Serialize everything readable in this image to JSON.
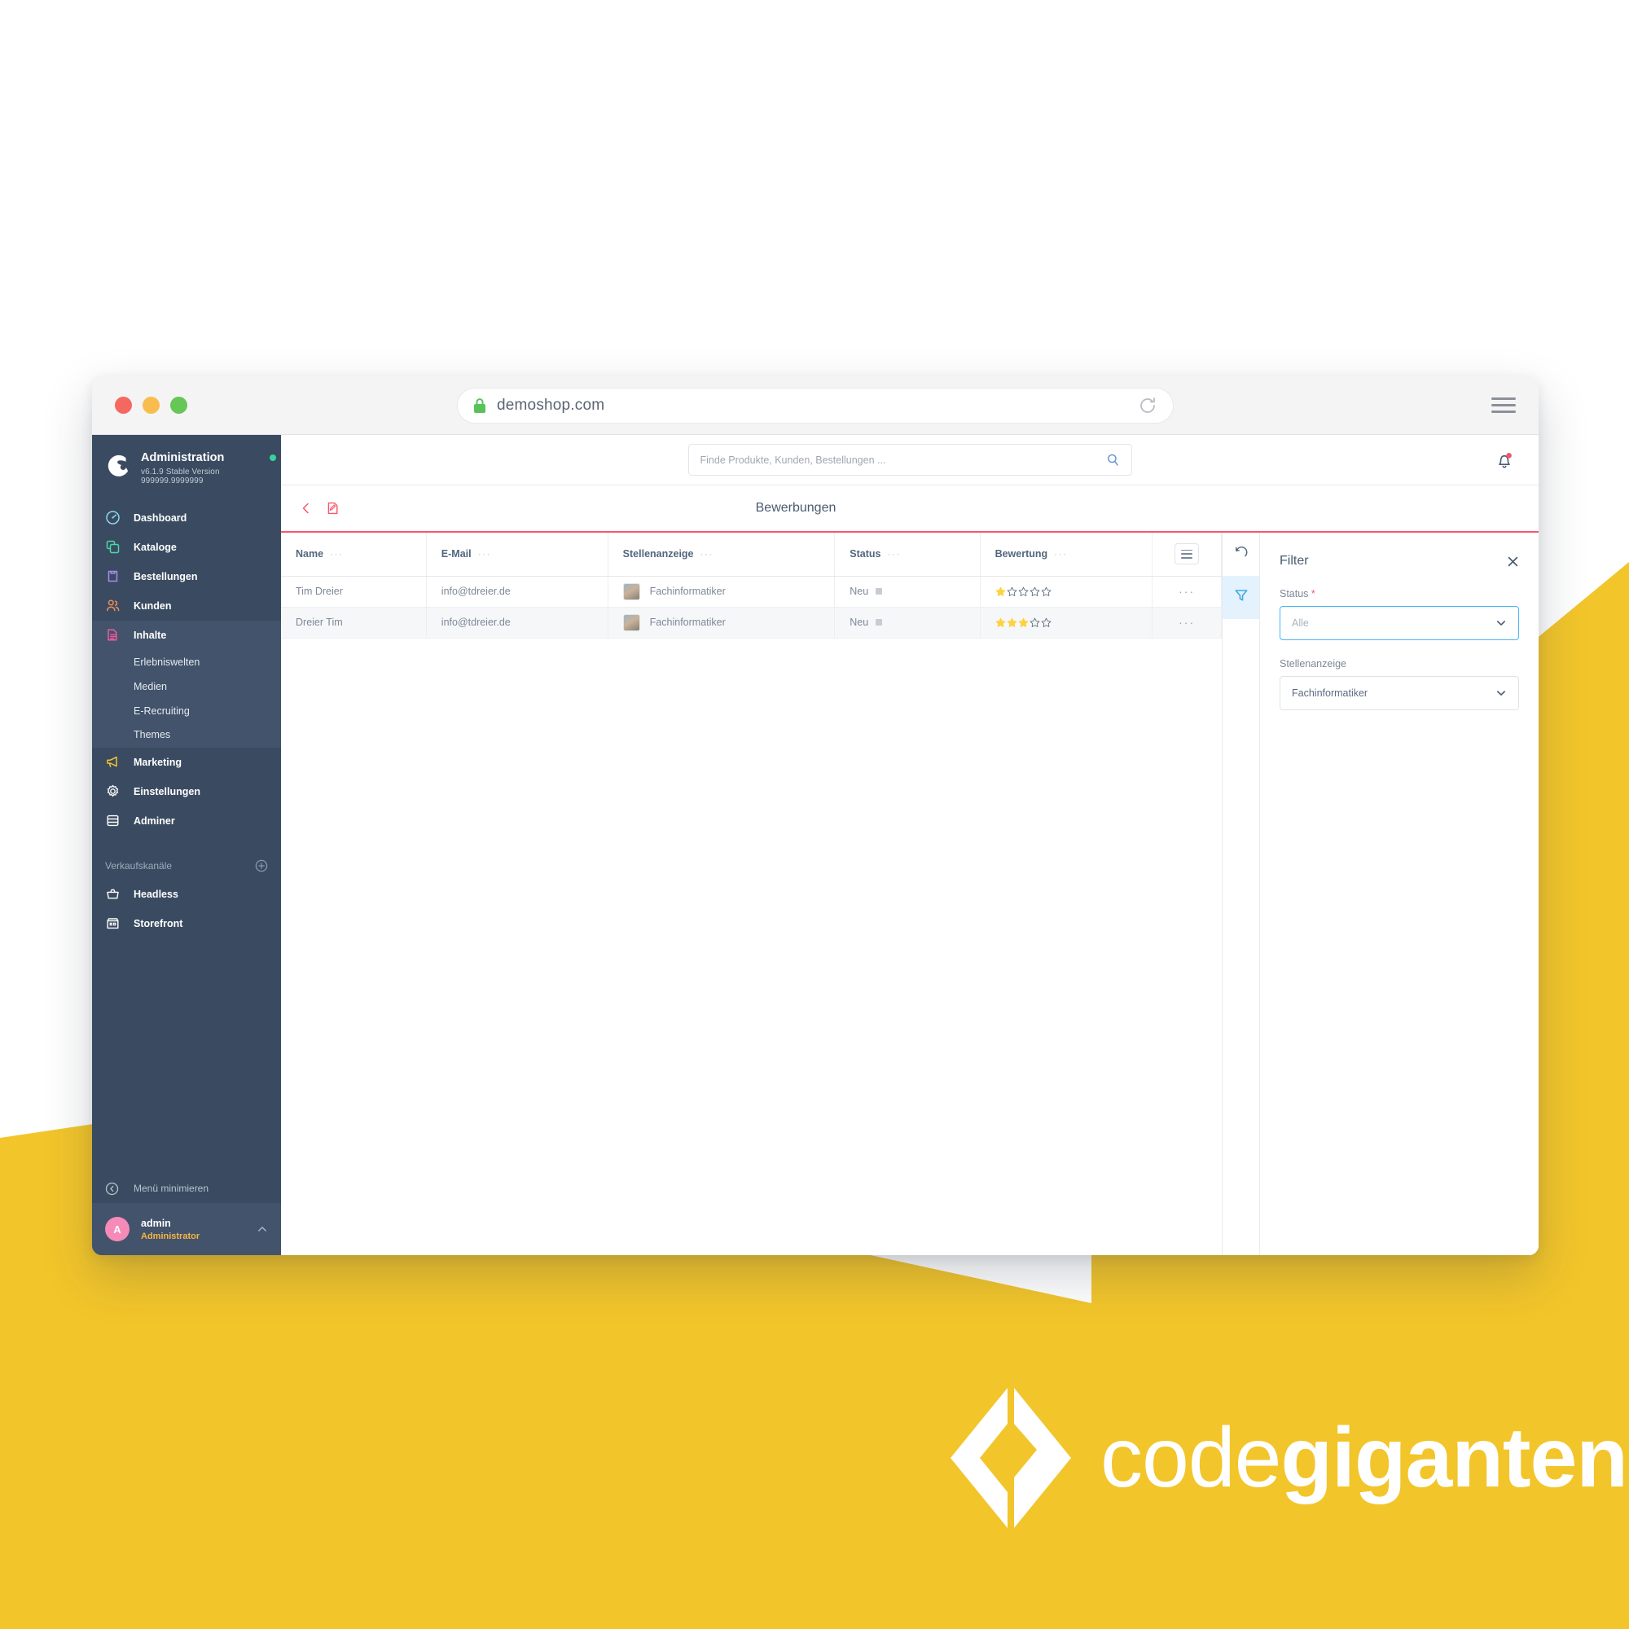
{
  "browser": {
    "url": "demoshop.com",
    "traffic_lights": [
      "close",
      "minimize",
      "maximize"
    ],
    "icons": {
      "lock": "lock-icon",
      "reload": "reload-icon",
      "menu": "hamburger-menu-icon"
    }
  },
  "sidebar": {
    "title": "Administration",
    "version": "v6.1.9 Stable Version 999999.9999999",
    "items": [
      {
        "label": "Dashboard",
        "icon": "dashboard-icon",
        "color": "#8bd6f0"
      },
      {
        "label": "Kataloge",
        "icon": "catalog-icon",
        "color": "#4ad8a6"
      },
      {
        "label": "Bestellungen",
        "icon": "orders-icon",
        "color": "#a98bf0"
      },
      {
        "label": "Kunden",
        "icon": "customers-icon",
        "color": "#f08d5a"
      },
      {
        "label": "Inhalte",
        "icon": "content-icon",
        "color": "#f25b9e",
        "active": true
      }
    ],
    "subitems": [
      {
        "label": "Erlebniswelten"
      },
      {
        "label": "Medien"
      },
      {
        "label": "E-Recruiting"
      },
      {
        "label": "Themes"
      }
    ],
    "items_after": [
      {
        "label": "Marketing",
        "icon": "megaphone-icon",
        "color": "#f2c52b"
      },
      {
        "label": "Einstellungen",
        "icon": "gear-icon",
        "color": "#ffffff"
      },
      {
        "label": "Adminer",
        "icon": "database-icon",
        "color": "#ffffff"
      }
    ],
    "section_label": "Verkaufskanäle",
    "section_add_icon": "plus-circle-icon",
    "channels": [
      {
        "label": "Headless",
        "icon": "basket-icon"
      },
      {
        "label": "Storefront",
        "icon": "store-icon"
      }
    ],
    "minimize_label": "Menü minimieren",
    "minimize_icon": "collapse-left-icon",
    "user": {
      "initial": "A",
      "name": "admin",
      "role": "Administrator",
      "chevron": "chevron-up-icon"
    }
  },
  "topbar": {
    "search_placeholder": "Finde Produkte, Kunden, Bestellungen ...",
    "search_value": "",
    "search_icon": "search-icon",
    "notification_icon": "bell-icon",
    "notification_badge": true
  },
  "pagebar": {
    "back_icon": "chevron-left-icon",
    "edit_icon": "edit-note-icon",
    "title": "Bewerbungen"
  },
  "table": {
    "columns": [
      {
        "label": "Name",
        "sort_icon": "more-dots"
      },
      {
        "label": "E-Mail",
        "sort_icon": "more-dots"
      },
      {
        "label": "Stellenanzeige",
        "sort_icon": "more-dots"
      },
      {
        "label": "Status",
        "sort_icon": "more-dots"
      },
      {
        "label": "Bewertung",
        "sort_icon": "more-dots"
      }
    ],
    "settings_icon": "column-settings-icon",
    "rows": [
      {
        "name": "Tim Dreier",
        "email": "info@tdreier.de",
        "job": "Fachinformatiker",
        "job_thumb": "job-thumbnail",
        "status": "Neu",
        "rating": 1,
        "rating_max": 5,
        "row_menu": "row-actions-icon"
      },
      {
        "name": "Dreier Tim",
        "email": "info@tdreier.de",
        "job": "Fachinformatiker",
        "job_thumb": "job-thumbnail",
        "status": "Neu",
        "rating": 3,
        "rating_max": 5,
        "row_menu": "row-actions-icon"
      }
    ]
  },
  "rail": {
    "refresh_icon": "refresh-icon",
    "filter_icon": "funnel-filter-icon",
    "filter_active": true
  },
  "filter_panel": {
    "title": "Filter",
    "close_icon": "close-icon",
    "fields": [
      {
        "label": "Status",
        "required": true,
        "value": "Alle",
        "is_placeholder": true,
        "focused": true,
        "chevron": "chevron-down-icon"
      },
      {
        "label": "Stellenanzeige",
        "required": false,
        "value": "Fachinformatiker",
        "is_placeholder": false,
        "focused": false,
        "chevron": "chevron-down-icon"
      }
    ]
  },
  "brand": {
    "mark": "codegiganten-logo",
    "text_light": "code",
    "text_bold": "giganten"
  },
  "colors": {
    "accent_red": "#f7566d",
    "sidebar_bg": "#3a4b61",
    "sidebar_active": "#42536b",
    "brand_yellow": "#f2c52b",
    "avatar_pink": "#f68ab8",
    "role_orange": "#f5b544",
    "star_gold": "#fcd23e",
    "filter_blue": "#47b6f5",
    "online_green": "#37d39b"
  }
}
